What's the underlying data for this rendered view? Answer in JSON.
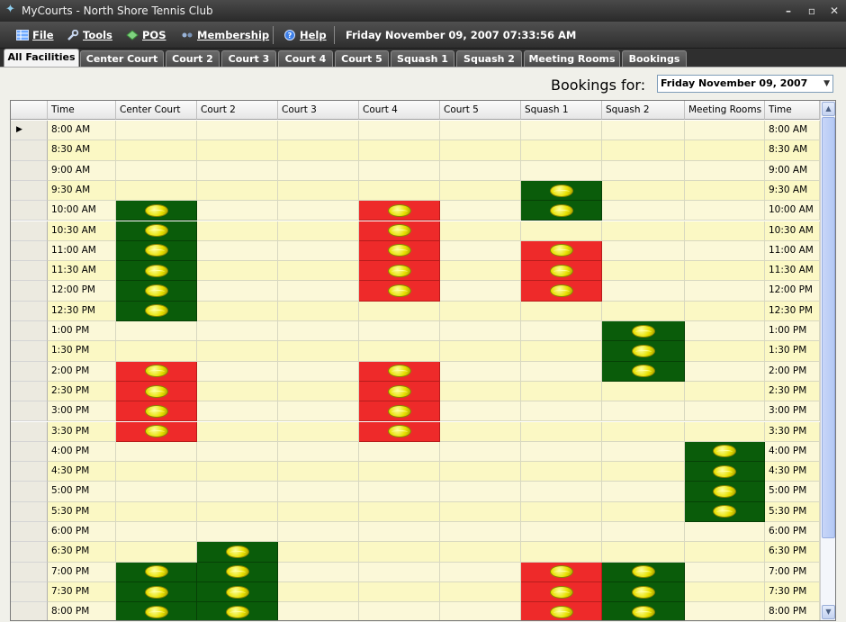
{
  "window": {
    "title": "MyCourts - North Shore Tennis Club",
    "min_glyph": "–",
    "max_glyph": "▫",
    "close_glyph": "✕"
  },
  "menu": {
    "file": "File",
    "tools": "Tools",
    "pos": "POS",
    "membership": "Membership",
    "help": "Help",
    "datetime": "Friday November 09, 2007 07:33:56 AM"
  },
  "tabs": [
    "All Facilities",
    "Center Court",
    "Court 2",
    "Court 3",
    "Court 4",
    "Court 5",
    "Squash 1",
    "Squash 2",
    "Meeting Rooms",
    "Bookings"
  ],
  "active_tab": 0,
  "bookings": {
    "label": "Bookings for:",
    "date": "Friday November 09, 2007",
    "dropdown_arrow": "▼"
  },
  "grid": {
    "columns": [
      "Time",
      "Center Court",
      "Court 2",
      "Court 3",
      "Court 4",
      "Court 5",
      "Squash 1",
      "Squash 2",
      "Meeting Rooms",
      "Time"
    ],
    "rows": [
      {
        "time": "8:00 AM",
        "cells": [
          "",
          "",
          "",
          "",
          "",
          "",
          "",
          ""
        ]
      },
      {
        "time": "8:30 AM",
        "cells": [
          "",
          "",
          "",
          "",
          "",
          "",
          "",
          ""
        ]
      },
      {
        "time": "9:00 AM",
        "cells": [
          "",
          "",
          "",
          "",
          "",
          "",
          "",
          ""
        ]
      },
      {
        "time": "9:30 AM",
        "cells": [
          "",
          "",
          "",
          "",
          "",
          "green",
          "",
          ""
        ]
      },
      {
        "time": "10:00 AM",
        "cells": [
          "green",
          "",
          "",
          "red",
          "",
          "green",
          "",
          ""
        ]
      },
      {
        "time": "10:30 AM",
        "cells": [
          "green",
          "",
          "",
          "red",
          "",
          "",
          "",
          ""
        ]
      },
      {
        "time": "11:00 AM",
        "cells": [
          "green",
          "",
          "",
          "red",
          "",
          "red",
          "",
          ""
        ]
      },
      {
        "time": "11:30 AM",
        "cells": [
          "green",
          "",
          "",
          "red",
          "",
          "red",
          "",
          ""
        ]
      },
      {
        "time": "12:00 PM",
        "cells": [
          "green",
          "",
          "",
          "red",
          "",
          "red",
          "",
          ""
        ]
      },
      {
        "time": "12:30 PM",
        "cells": [
          "green",
          "",
          "",
          "",
          "",
          "",
          "",
          ""
        ]
      },
      {
        "time": "1:00 PM",
        "cells": [
          "",
          "",
          "",
          "",
          "",
          "",
          "green",
          ""
        ]
      },
      {
        "time": "1:30 PM",
        "cells": [
          "",
          "",
          "",
          "",
          "",
          "",
          "green",
          ""
        ]
      },
      {
        "time": "2:00 PM",
        "cells": [
          "red",
          "",
          "",
          "red",
          "",
          "",
          "green",
          ""
        ]
      },
      {
        "time": "2:30 PM",
        "cells": [
          "red",
          "",
          "",
          "red",
          "",
          "",
          "",
          ""
        ]
      },
      {
        "time": "3:00 PM",
        "cells": [
          "red",
          "",
          "",
          "red",
          "",
          "",
          "",
          ""
        ]
      },
      {
        "time": "3:30 PM",
        "cells": [
          "red",
          "",
          "",
          "red",
          "",
          "",
          "",
          ""
        ]
      },
      {
        "time": "4:00 PM",
        "cells": [
          "",
          "",
          "",
          "",
          "",
          "",
          "",
          "green"
        ]
      },
      {
        "time": "4:30 PM",
        "cells": [
          "",
          "",
          "",
          "",
          "",
          "",
          "",
          "green"
        ]
      },
      {
        "time": "5:00 PM",
        "cells": [
          "",
          "",
          "",
          "",
          "",
          "",
          "",
          "green"
        ]
      },
      {
        "time": "5:30 PM",
        "cells": [
          "",
          "",
          "",
          "",
          "",
          "",
          "",
          "green"
        ]
      },
      {
        "time": "6:00 PM",
        "cells": [
          "",
          "",
          "",
          "",
          "",
          "",
          "",
          ""
        ]
      },
      {
        "time": "6:30 PM",
        "cells": [
          "",
          "green",
          "",
          "",
          "",
          "",
          "",
          ""
        ]
      },
      {
        "time": "7:00 PM",
        "cells": [
          "green",
          "green",
          "",
          "",
          "",
          "red",
          "green",
          ""
        ]
      },
      {
        "time": "7:30 PM",
        "cells": [
          "green",
          "green",
          "",
          "",
          "",
          "red",
          "green",
          ""
        ]
      },
      {
        "time": "8:00 PM",
        "cells": [
          "green",
          "green",
          "",
          "",
          "",
          "red",
          "green",
          ""
        ]
      }
    ],
    "selected_row_marker": "▶"
  },
  "scrollbar": {
    "up_glyph": "▲",
    "down_glyph": "▼"
  },
  "colors": {
    "confirmed": "#0a5c0a",
    "pending": "#ee2a2a",
    "ball": "#e8e000"
  },
  "icons": [
    "grid-icon",
    "wrench-icon",
    "pos-icon",
    "membership-icon",
    "help-icon",
    "tennis-ball-icon"
  ]
}
